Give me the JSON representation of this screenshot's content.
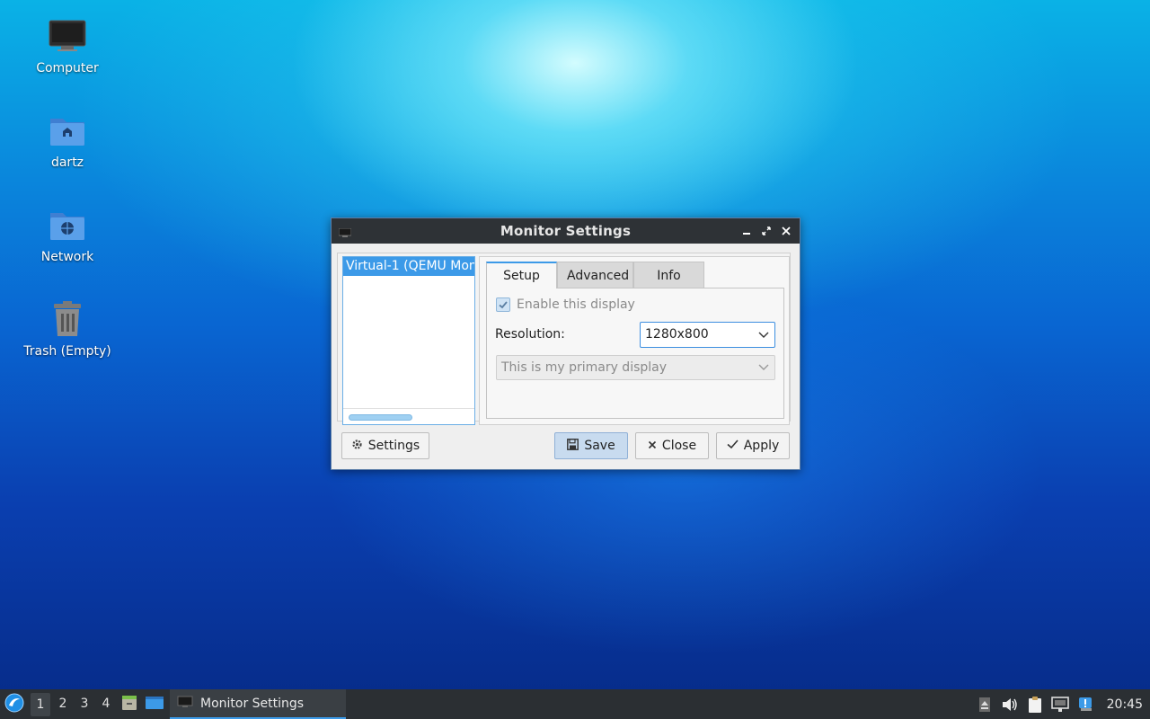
{
  "desktop": {
    "icons": [
      {
        "label": "Computer",
        "icon": "computer-icon"
      },
      {
        "label": "dartz",
        "icon": "home-folder-icon"
      },
      {
        "label": "Network",
        "icon": "network-folder-icon"
      },
      {
        "label": "Trash (Empty)",
        "icon": "trash-icon"
      }
    ]
  },
  "window": {
    "title": "Monitor Settings",
    "monitors": [
      "Virtual-1 (QEMU Mon"
    ],
    "tabs": [
      {
        "label": "Setup",
        "active": true
      },
      {
        "label": "Advanced",
        "active": false
      },
      {
        "label": "Info",
        "active": false
      }
    ],
    "setup": {
      "enable_label": "Enable this display",
      "enable_checked": true,
      "resolution_label": "Resolution:",
      "resolution_value": "1280x800",
      "primary_value": "This is my primary display"
    },
    "buttons": {
      "settings": "Settings",
      "save": "Save",
      "close": "Close",
      "apply": "Apply"
    }
  },
  "taskbar": {
    "workspaces": [
      "1",
      "2",
      "3",
      "4"
    ],
    "active_workspace": "1",
    "task_label": "Monitor Settings",
    "clock": "20:45"
  },
  "colors": {
    "accent": "#3c9ae8",
    "titlebar": "#2e3236",
    "taskbar": "#2b2f33"
  }
}
